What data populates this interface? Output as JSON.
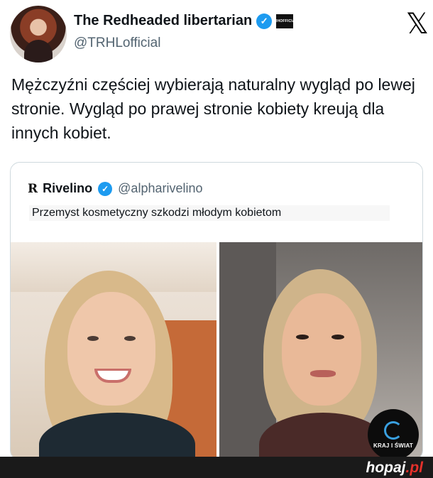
{
  "author": {
    "display_name": "The Redheaded libertarian",
    "handle": "@TRHLofficial",
    "affiliate_badge": "TRHOFFICIAL"
  },
  "platform_icon": "x-logo-icon",
  "tweet": {
    "text": "Mężczyźni częściej wybierają naturalny wygląd po lewej stronie. Wygląd po prawej stronie kobiety kreują dla innych kobiet."
  },
  "quoted_tweet": {
    "logo": "R",
    "display_name": "Rivelino",
    "handle": "@alpharivelino",
    "text": "Przemyst kosmetyczny szkodzi młodym kobietom"
  },
  "watermark": {
    "label": "KRAJ I ŚWIAT"
  },
  "footer": {
    "brand_main": "hopaj",
    "brand_suffix": ".pl"
  },
  "colors": {
    "verified_blue": "#1d9bf0",
    "footer_bg": "#1a1a1a",
    "brand_red": "#e6312b"
  }
}
